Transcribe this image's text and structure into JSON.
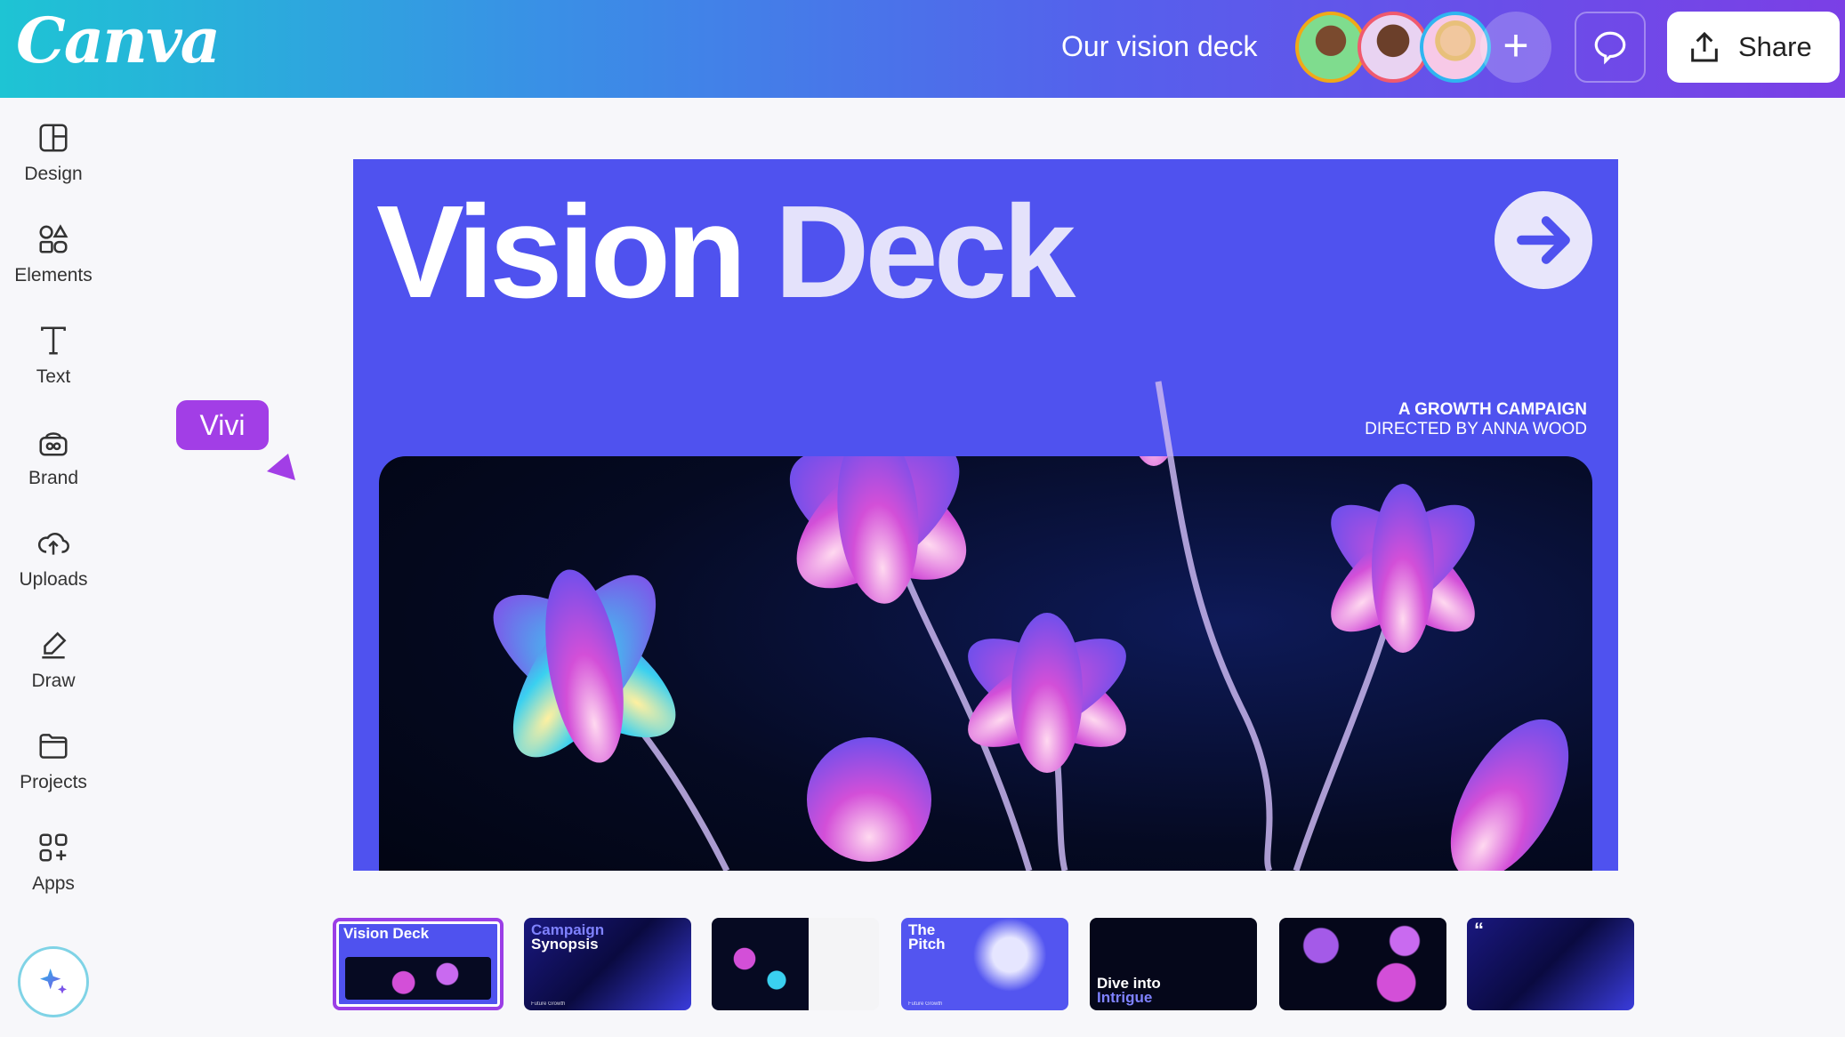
{
  "header": {
    "logo": "Canva",
    "doc_title": "Our vision deck",
    "share_label": "Share",
    "avatars": [
      {
        "name": "collaborator-1",
        "ring": "#f0a818",
        "bg": "#7fdc8e"
      },
      {
        "name": "collaborator-2",
        "ring": "#f05a6e",
        "bg": "#e9d3f2"
      },
      {
        "name": "collaborator-3",
        "ring": "#2fb5f0",
        "bg": "#f7c9e7"
      }
    ]
  },
  "sidebar": {
    "items": [
      {
        "label": "Design",
        "icon": "layout-icon"
      },
      {
        "label": "Elements",
        "icon": "shapes-icon"
      },
      {
        "label": "Text",
        "icon": "text-icon"
      },
      {
        "label": "Brand",
        "icon": "brand-icon"
      },
      {
        "label": "Uploads",
        "icon": "cloud-upload-icon"
      },
      {
        "label": "Draw",
        "icon": "pen-icon"
      },
      {
        "label": "Projects",
        "icon": "folder-icon"
      },
      {
        "label": "Apps",
        "icon": "apps-icon"
      }
    ]
  },
  "cursor_tag": {
    "label": "Vivi",
    "color": "#a23ee6"
  },
  "slide": {
    "title_part1": "Vision",
    "title_part2": "Deck",
    "subtitle_line1": "A GROWTH CAMPAIGN",
    "subtitle_line2": "DIRECTED BY ANNA WOOD",
    "bg": "#4f52ef"
  },
  "thumbnails": [
    {
      "title": "Vision Deck",
      "footer": "",
      "selected": true
    },
    {
      "title": "Campaign",
      "title2": "Synopsis",
      "footer": "Future Growth"
    },
    {
      "title": "",
      "footer": ""
    },
    {
      "title": "The",
      "title2": "Pitch",
      "footer": "Future Growth"
    },
    {
      "title": "Dive into",
      "title2": "Intrigue",
      "footer": ""
    },
    {
      "title": "",
      "footer": ""
    },
    {
      "title": "“",
      "footer": ""
    }
  ]
}
